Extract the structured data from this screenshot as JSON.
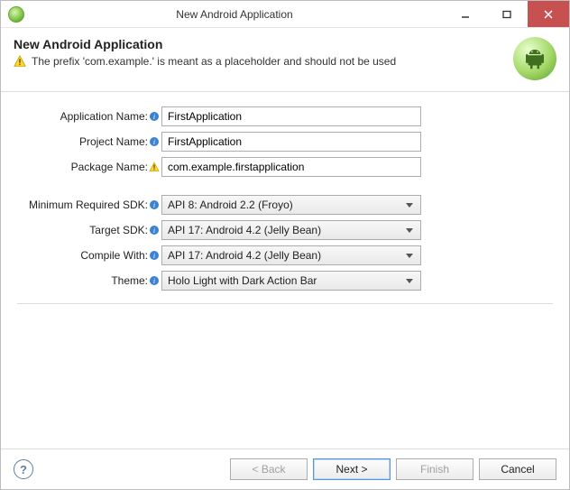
{
  "window": {
    "title": "New Android Application"
  },
  "banner": {
    "heading": "New Android Application",
    "message": "The prefix 'com.example.' is meant as a placeholder and should not be used"
  },
  "form": {
    "applicationName": {
      "label": "Application Name:",
      "value": "FirstApplication"
    },
    "projectName": {
      "label": "Project Name:",
      "value": "FirstApplication"
    },
    "packageName": {
      "label": "Package Name:",
      "value": "com.example.firstapplication"
    },
    "minSdk": {
      "label": "Minimum Required SDK:",
      "value": "API 8: Android 2.2 (Froyo)"
    },
    "targetSdk": {
      "label": "Target SDK:",
      "value": "API 17: Android 4.2 (Jelly Bean)"
    },
    "compile": {
      "label": "Compile With:",
      "value": "API 17: Android 4.2 (Jelly Bean)"
    },
    "theme": {
      "label": "Theme:",
      "value": "Holo Light with Dark Action Bar"
    }
  },
  "buttons": {
    "back": "< Back",
    "next": "Next >",
    "finish": "Finish",
    "cancel": "Cancel"
  }
}
